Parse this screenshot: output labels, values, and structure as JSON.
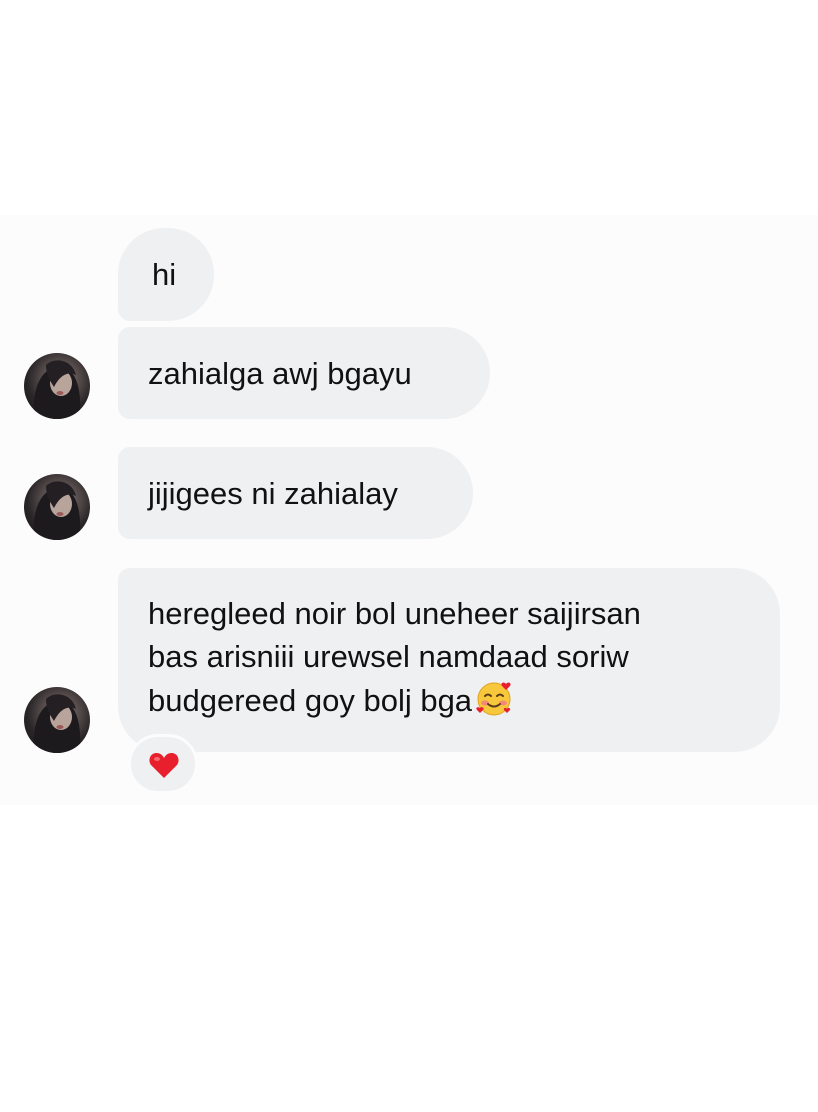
{
  "conversation": {
    "messages": [
      {
        "lines": [
          "hi"
        ]
      },
      {
        "lines": [
          "zahialga awj bgayu"
        ]
      },
      {
        "lines": [
          "jijigees ni zahialay"
        ]
      },
      {
        "lines": [
          "heregleed noir bol uneheer saijirsan",
          "bas arisniii urewsel namdaad soriw",
          "budgereed goy bolj bga"
        ],
        "trailing_emoji": "smiling-face-with-hearts-icon"
      }
    ],
    "reaction": {
      "icon": "red-heart-icon",
      "color": "#e8202e"
    },
    "colors": {
      "bubble": "#eff0f2",
      "panel": "#fcfcfc",
      "text": "#111111"
    }
  }
}
